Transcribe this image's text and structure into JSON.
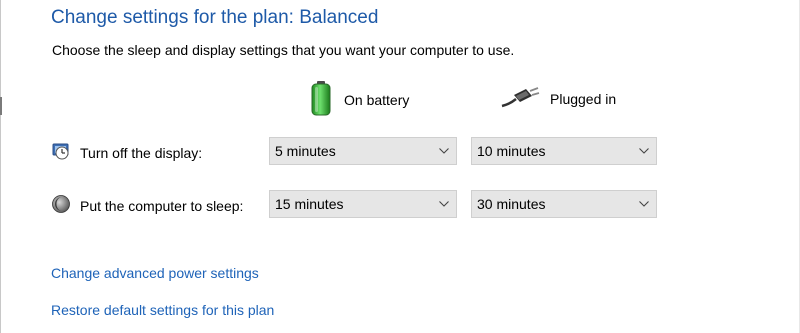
{
  "header": {
    "title": "Change settings for the plan: Balanced",
    "subtitle": "Choose the sleep and display settings that you want your computer to use."
  },
  "columns": {
    "battery_label": "On battery",
    "plugged_label": "Plugged in",
    "battery_icon": "battery-icon",
    "plugged_icon": "power-plug-icon"
  },
  "rows": {
    "display": {
      "label": "Turn off the display:",
      "icon": "display-icon",
      "on_battery": "5 minutes",
      "plugged_in": "10 minutes"
    },
    "sleep": {
      "label": "Put the computer to sleep:",
      "icon": "sleep-moon-icon",
      "on_battery": "15 minutes",
      "plugged_in": "30 minutes"
    }
  },
  "links": {
    "advanced": "Change advanced power settings",
    "restore": "Restore default settings for this plan"
  },
  "colors": {
    "title": "#1e5aa8",
    "link": "#1e63b8",
    "dropdown_bg": "#e6e6e6",
    "dropdown_border": "#cfcfcf"
  }
}
